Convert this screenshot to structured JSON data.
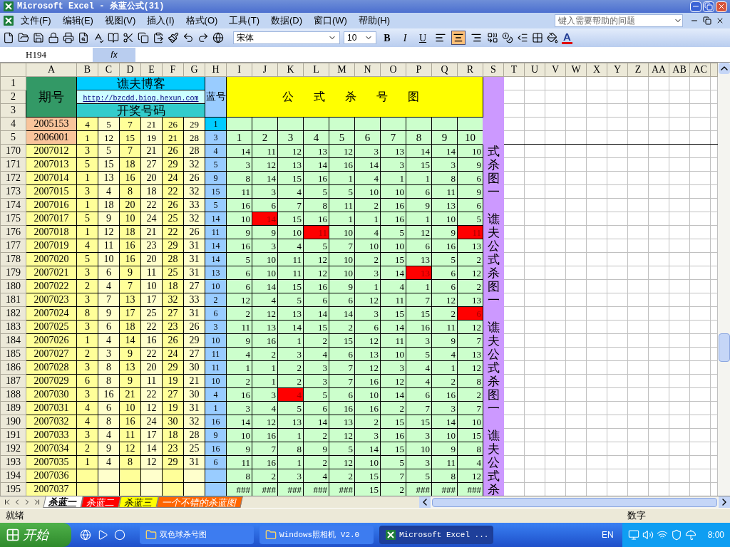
{
  "window": {
    "title": "Microsoft Excel - 杀蓝公式(31)"
  },
  "menu": [
    "文件(F)",
    "编辑(E)",
    "视图(V)",
    "插入(I)",
    "格式(O)",
    "工具(T)",
    "数据(D)",
    "窗口(W)",
    "帮助(H)"
  ],
  "help_box": {
    "placeholder": "键入需要帮助的问题"
  },
  "toolbar": {
    "font": "宋体",
    "size": "10",
    "styles": [
      "B",
      "I",
      "U"
    ],
    "align": [
      {
        "kind": "left",
        "selected": false
      },
      {
        "kind": "center",
        "selected": true
      },
      {
        "kind": "right",
        "selected": false
      }
    ],
    "font_color_label": "A"
  },
  "formula_bar": {
    "name_box": "H194",
    "fx": "fx"
  },
  "columns": [
    "A",
    "B",
    "C",
    "D",
    "E",
    "F",
    "G",
    "H",
    "I",
    "J",
    "K",
    "L",
    "M",
    "N",
    "O",
    "P",
    "Q",
    "R",
    "S",
    "T",
    "U",
    "V",
    "W",
    "X",
    "Y",
    "Z",
    "AA",
    "AB",
    "AC"
  ],
  "header": {
    "rows": [
      "1",
      "2",
      "3"
    ],
    "period_label": "期号",
    "blog": "谯夫博客",
    "link": "http://bzcdd.biog.hexun.com",
    "draw_label": "开奖号码",
    "blue_label": "蓝号",
    "chart_title": "公 式 杀 号 图"
  },
  "top_rows": [
    {
      "row": "4",
      "period": "2005153",
      "numbers": [
        "4",
        "5",
        "7",
        "21",
        "26",
        "29"
      ],
      "blue": "1"
    },
    {
      "row": "5",
      "period": "2006001",
      "numbers": [
        "1",
        "12",
        "15",
        "19",
        "21",
        "28"
      ],
      "blue": "3",
      "formula": [
        "1",
        "2",
        "3",
        "4",
        "5",
        "6",
        "7",
        "8",
        "9",
        "10"
      ]
    }
  ],
  "rows": [
    {
      "row": "170",
      "period": "2007012",
      "numbers": [
        "3",
        "5",
        "7",
        "21",
        "26",
        "28"
      ],
      "blue": "4",
      "side": "式",
      "formula": [
        {
          "v": "14",
          "hit": false
        },
        {
          "v": "11",
          "hit": false
        },
        {
          "v": "12",
          "hit": false
        },
        {
          "v": "13",
          "hit": false
        },
        {
          "v": "12",
          "hit": false
        },
        {
          "v": "3",
          "hit": false
        },
        {
          "v": "13",
          "hit": false
        },
        {
          "v": "14",
          "hit": false
        },
        {
          "v": "14",
          "hit": false
        },
        {
          "v": "10",
          "hit": false
        }
      ]
    },
    {
      "row": "171",
      "period": "2007013",
      "numbers": [
        "5",
        "15",
        "18",
        "27",
        "29",
        "32"
      ],
      "blue": "5",
      "side": "杀",
      "formula": [
        {
          "v": "3",
          "hit": false
        },
        {
          "v": "12",
          "hit": false
        },
        {
          "v": "13",
          "hit": false
        },
        {
          "v": "14",
          "hit": false
        },
        {
          "v": "16",
          "hit": false
        },
        {
          "v": "14",
          "hit": false
        },
        {
          "v": "3",
          "hit": false
        },
        {
          "v": "15",
          "hit": false
        },
        {
          "v": "3",
          "hit": false
        },
        {
          "v": "9",
          "hit": false
        }
      ]
    },
    {
      "row": "172",
      "period": "2007014",
      "numbers": [
        "1",
        "13",
        "16",
        "20",
        "24",
        "26"
      ],
      "blue": "9",
      "side": "图",
      "formula": [
        {
          "v": "8",
          "hit": false
        },
        {
          "v": "14",
          "hit": false
        },
        {
          "v": "15",
          "hit": false
        },
        {
          "v": "16",
          "hit": false
        },
        {
          "v": "1",
          "hit": false
        },
        {
          "v": "4",
          "hit": false
        },
        {
          "v": "1",
          "hit": false
        },
        {
          "v": "1",
          "hit": false
        },
        {
          "v": "8",
          "hit": false
        },
        {
          "v": "6",
          "hit": false
        }
      ]
    },
    {
      "row": "173",
      "period": "2007015",
      "numbers": [
        "3",
        "4",
        "8",
        "18",
        "22",
        "32"
      ],
      "blue": "15",
      "side": "一",
      "formula": [
        {
          "v": "11",
          "hit": false
        },
        {
          "v": "3",
          "hit": false
        },
        {
          "v": "4",
          "hit": false
        },
        {
          "v": "5",
          "hit": false
        },
        {
          "v": "5",
          "hit": false
        },
        {
          "v": "10",
          "hit": false
        },
        {
          "v": "10",
          "hit": false
        },
        {
          "v": "6",
          "hit": false
        },
        {
          "v": "11",
          "hit": false
        },
        {
          "v": "9",
          "hit": false
        }
      ]
    },
    {
      "row": "174",
      "period": "2007016",
      "numbers": [
        "1",
        "18",
        "20",
        "22",
        "26",
        "33"
      ],
      "blue": "5",
      "formula": [
        {
          "v": "16",
          "hit": false
        },
        {
          "v": "6",
          "hit": false
        },
        {
          "v": "7",
          "hit": false
        },
        {
          "v": "8",
          "hit": false
        },
        {
          "v": "11",
          "hit": false
        },
        {
          "v": "2",
          "hit": false
        },
        {
          "v": "16",
          "hit": false
        },
        {
          "v": "9",
          "hit": false
        },
        {
          "v": "13",
          "hit": false
        },
        {
          "v": "6",
          "hit": false
        }
      ]
    },
    {
      "row": "175",
      "period": "2007017",
      "numbers": [
        "5",
        "9",
        "10",
        "24",
        "25",
        "32"
      ],
      "blue": "14",
      "side": "谯",
      "formula": [
        {
          "v": "10",
          "hit": false
        },
        {
          "v": "14",
          "hit": true
        },
        {
          "v": "15",
          "hit": false
        },
        {
          "v": "16",
          "hit": false
        },
        {
          "v": "1",
          "hit": false
        },
        {
          "v": "1",
          "hit": false
        },
        {
          "v": "16",
          "hit": false
        },
        {
          "v": "1",
          "hit": false
        },
        {
          "v": "10",
          "hit": false
        },
        {
          "v": "5",
          "hit": false
        }
      ]
    },
    {
      "row": "176",
      "period": "2007018",
      "numbers": [
        "1",
        "12",
        "18",
        "21",
        "22",
        "26"
      ],
      "blue": "11",
      "side": "夫",
      "formula": [
        {
          "v": "9",
          "hit": false
        },
        {
          "v": "9",
          "hit": false
        },
        {
          "v": "10",
          "hit": false
        },
        {
          "v": "11",
          "hit": true
        },
        {
          "v": "10",
          "hit": false
        },
        {
          "v": "4",
          "hit": false
        },
        {
          "v": "5",
          "hit": false
        },
        {
          "v": "12",
          "hit": false
        },
        {
          "v": "9",
          "hit": false
        },
        {
          "v": "11",
          "hit": true
        }
      ]
    },
    {
      "row": "177",
      "period": "2007019",
      "numbers": [
        "4",
        "11",
        "16",
        "23",
        "29",
        "31"
      ],
      "blue": "14",
      "side": "公",
      "formula": [
        {
          "v": "16",
          "hit": false
        },
        {
          "v": "3",
          "hit": false
        },
        {
          "v": "4",
          "hit": false
        },
        {
          "v": "5",
          "hit": false
        },
        {
          "v": "7",
          "hit": false
        },
        {
          "v": "10",
          "hit": false
        },
        {
          "v": "10",
          "hit": false
        },
        {
          "v": "6",
          "hit": false
        },
        {
          "v": "16",
          "hit": false
        },
        {
          "v": "13",
          "hit": false
        }
      ]
    },
    {
      "row": "178",
      "period": "2007020",
      "numbers": [
        "5",
        "10",
        "16",
        "20",
        "28",
        "31"
      ],
      "blue": "14",
      "side": "式",
      "formula": [
        {
          "v": "5",
          "hit": false
        },
        {
          "v": "10",
          "hit": false
        },
        {
          "v": "11",
          "hit": false
        },
        {
          "v": "12",
          "hit": false
        },
        {
          "v": "10",
          "hit": false
        },
        {
          "v": "2",
          "hit": false
        },
        {
          "v": "15",
          "hit": false
        },
        {
          "v": "13",
          "hit": false
        },
        {
          "v": "5",
          "hit": false
        },
        {
          "v": "2",
          "hit": false
        }
      ]
    },
    {
      "row": "179",
      "period": "2007021",
      "numbers": [
        "3",
        "6",
        "9",
        "11",
        "25",
        "31"
      ],
      "blue": "13",
      "side": "杀",
      "formula": [
        {
          "v": "6",
          "hit": false
        },
        {
          "v": "10",
          "hit": false
        },
        {
          "v": "11",
          "hit": false
        },
        {
          "v": "12",
          "hit": false
        },
        {
          "v": "10",
          "hit": false
        },
        {
          "v": "3",
          "hit": false
        },
        {
          "v": "14",
          "hit": false
        },
        {
          "v": "13",
          "hit": true
        },
        {
          "v": "6",
          "hit": false
        },
        {
          "v": "12",
          "hit": false
        }
      ]
    },
    {
      "row": "180",
      "period": "2007022",
      "numbers": [
        "2",
        "4",
        "7",
        "10",
        "18",
        "27"
      ],
      "blue": "10",
      "side": "图",
      "formula": [
        {
          "v": "6",
          "hit": false
        },
        {
          "v": "14",
          "hit": false
        },
        {
          "v": "15",
          "hit": false
        },
        {
          "v": "16",
          "hit": false
        },
        {
          "v": "9",
          "hit": false
        },
        {
          "v": "1",
          "hit": false
        },
        {
          "v": "4",
          "hit": false
        },
        {
          "v": "1",
          "hit": false
        },
        {
          "v": "6",
          "hit": false
        },
        {
          "v": "2",
          "hit": false
        }
      ]
    },
    {
      "row": "181",
      "period": "2007023",
      "numbers": [
        "3",
        "7",
        "13",
        "17",
        "32",
        "33"
      ],
      "blue": "2",
      "side": "一",
      "formula": [
        {
          "v": "12",
          "hit": false
        },
        {
          "v": "4",
          "hit": false
        },
        {
          "v": "5",
          "hit": false
        },
        {
          "v": "6",
          "hit": false
        },
        {
          "v": "6",
          "hit": false
        },
        {
          "v": "12",
          "hit": false
        },
        {
          "v": "11",
          "hit": false
        },
        {
          "v": "7",
          "hit": false
        },
        {
          "v": "12",
          "hit": false
        },
        {
          "v": "13",
          "hit": false
        }
      ]
    },
    {
      "row": "182",
      "period": "2007024",
      "numbers": [
        "8",
        "9",
        "17",
        "25",
        "27",
        "31"
      ],
      "blue": "6",
      "formula": [
        {
          "v": "2",
          "hit": false
        },
        {
          "v": "12",
          "hit": false
        },
        {
          "v": "13",
          "hit": false
        },
        {
          "v": "14",
          "hit": false
        },
        {
          "v": "14",
          "hit": false
        },
        {
          "v": "3",
          "hit": false
        },
        {
          "v": "15",
          "hit": false
        },
        {
          "v": "15",
          "hit": false
        },
        {
          "v": "2",
          "hit": false
        },
        {
          "v": "6",
          "hit": true
        }
      ]
    },
    {
      "row": "183",
      "period": "2007025",
      "numbers": [
        "3",
        "6",
        "18",
        "22",
        "23",
        "26"
      ],
      "blue": "3",
      "side": "谯",
      "formula": [
        {
          "v": "11",
          "hit": false
        },
        {
          "v": "13",
          "hit": false
        },
        {
          "v": "14",
          "hit": false
        },
        {
          "v": "15",
          "hit": false
        },
        {
          "v": "2",
          "hit": false
        },
        {
          "v": "6",
          "hit": false
        },
        {
          "v": "14",
          "hit": false
        },
        {
          "v": "16",
          "hit": false
        },
        {
          "v": "11",
          "hit": false
        },
        {
          "v": "12",
          "hit": false
        }
      ]
    },
    {
      "row": "184",
      "period": "2007026",
      "numbers": [
        "1",
        "4",
        "14",
        "16",
        "26",
        "29"
      ],
      "blue": "10",
      "side": "夫",
      "formula": [
        {
          "v": "9",
          "hit": false
        },
        {
          "v": "16",
          "hit": false
        },
        {
          "v": "1",
          "hit": false
        },
        {
          "v": "2",
          "hit": false
        },
        {
          "v": "15",
          "hit": false
        },
        {
          "v": "12",
          "hit": false
        },
        {
          "v": "11",
          "hit": false
        },
        {
          "v": "3",
          "hit": false
        },
        {
          "v": "9",
          "hit": false
        },
        {
          "v": "7",
          "hit": false
        }
      ]
    },
    {
      "row": "185",
      "period": "2007027",
      "numbers": [
        "2",
        "3",
        "9",
        "22",
        "24",
        "27"
      ],
      "blue": "11",
      "side": "公",
      "formula": [
        {
          "v": "4",
          "hit": false
        },
        {
          "v": "2",
          "hit": false
        },
        {
          "v": "3",
          "hit": false
        },
        {
          "v": "4",
          "hit": false
        },
        {
          "v": "6",
          "hit": false
        },
        {
          "v": "13",
          "hit": false
        },
        {
          "v": "10",
          "hit": false
        },
        {
          "v": "5",
          "hit": false
        },
        {
          "v": "4",
          "hit": false
        },
        {
          "v": "13",
          "hit": false
        }
      ]
    },
    {
      "row": "186",
      "period": "2007028",
      "numbers": [
        "3",
        "8",
        "13",
        "20",
        "29",
        "30"
      ],
      "blue": "11",
      "side": "式",
      "formula": [
        {
          "v": "1",
          "hit": false
        },
        {
          "v": "1",
          "hit": false
        },
        {
          "v": "2",
          "hit": false
        },
        {
          "v": "3",
          "hit": false
        },
        {
          "v": "7",
          "hit": false
        },
        {
          "v": "12",
          "hit": false
        },
        {
          "v": "3",
          "hit": false
        },
        {
          "v": "4",
          "hit": false
        },
        {
          "v": "1",
          "hit": false
        },
        {
          "v": "12",
          "hit": false
        }
      ]
    },
    {
      "row": "187",
      "period": "2007029",
      "numbers": [
        "6",
        "8",
        "9",
        "11",
        "19",
        "21"
      ],
      "blue": "10",
      "side": "杀",
      "formula": [
        {
          "v": "2",
          "hit": false
        },
        {
          "v": "1",
          "hit": false
        },
        {
          "v": "2",
          "hit": false
        },
        {
          "v": "3",
          "hit": false
        },
        {
          "v": "7",
          "hit": false
        },
        {
          "v": "16",
          "hit": false
        },
        {
          "v": "12",
          "hit": false
        },
        {
          "v": "4",
          "hit": false
        },
        {
          "v": "2",
          "hit": false
        },
        {
          "v": "8",
          "hit": false
        }
      ]
    },
    {
      "row": "188",
      "period": "2007030",
      "numbers": [
        "3",
        "16",
        "21",
        "22",
        "27",
        "30"
      ],
      "blue": "4",
      "side": "图",
      "formula": [
        {
          "v": "16",
          "hit": false
        },
        {
          "v": "3",
          "hit": false
        },
        {
          "v": "4",
          "hit": true
        },
        {
          "v": "5",
          "hit": false
        },
        {
          "v": "6",
          "hit": false
        },
        {
          "v": "10",
          "hit": false
        },
        {
          "v": "14",
          "hit": false
        },
        {
          "v": "6",
          "hit": false
        },
        {
          "v": "16",
          "hit": false
        },
        {
          "v": "2",
          "hit": false
        }
      ]
    },
    {
      "row": "189",
      "period": "2007031",
      "numbers": [
        "4",
        "6",
        "10",
        "12",
        "19",
        "31"
      ],
      "blue": "1",
      "side": "一",
      "formula": [
        {
          "v": "3",
          "hit": false
        },
        {
          "v": "4",
          "hit": false
        },
        {
          "v": "5",
          "hit": false
        },
        {
          "v": "6",
          "hit": false
        },
        {
          "v": "16",
          "hit": false
        },
        {
          "v": "16",
          "hit": false
        },
        {
          "v": "2",
          "hit": false
        },
        {
          "v": "7",
          "hit": false
        },
        {
          "v": "3",
          "hit": false
        },
        {
          "v": "7",
          "hit": false
        }
      ]
    },
    {
      "row": "190",
      "period": "2007032",
      "numbers": [
        "4",
        "8",
        "16",
        "24",
        "30",
        "32"
      ],
      "blue": "16",
      "formula": [
        {
          "v": "14",
          "hit": false
        },
        {
          "v": "12",
          "hit": false
        },
        {
          "v": "13",
          "hit": false
        },
        {
          "v": "14",
          "hit": false
        },
        {
          "v": "13",
          "hit": false
        },
        {
          "v": "2",
          "hit": false
        },
        {
          "v": "15",
          "hit": false
        },
        {
          "v": "15",
          "hit": false
        },
        {
          "v": "14",
          "hit": false
        },
        {
          "v": "10",
          "hit": false
        }
      ]
    },
    {
      "row": "191",
      "period": "2007033",
      "numbers": [
        "3",
        "4",
        "11",
        "17",
        "18",
        "28"
      ],
      "blue": "9",
      "side": "谯",
      "formula": [
        {
          "v": "10",
          "hit": false
        },
        {
          "v": "16",
          "hit": false
        },
        {
          "v": "1",
          "hit": false
        },
        {
          "v": "2",
          "hit": false
        },
        {
          "v": "12",
          "hit": false
        },
        {
          "v": "3",
          "hit": false
        },
        {
          "v": "16",
          "hit": false
        },
        {
          "v": "3",
          "hit": false
        },
        {
          "v": "10",
          "hit": false
        },
        {
          "v": "15",
          "hit": false
        }
      ]
    },
    {
      "row": "192",
      "period": "2007034",
      "numbers": [
        "2",
        "9",
        "12",
        "14",
        "23",
        "25"
      ],
      "blue": "16",
      "side": "夫",
      "formula": [
        {
          "v": "9",
          "hit": false
        },
        {
          "v": "7",
          "hit": false
        },
        {
          "v": "8",
          "hit": false
        },
        {
          "v": "9",
          "hit": false
        },
        {
          "v": "5",
          "hit": false
        },
        {
          "v": "14",
          "hit": false
        },
        {
          "v": "15",
          "hit": false
        },
        {
          "v": "10",
          "hit": false
        },
        {
          "v": "9",
          "hit": false
        },
        {
          "v": "8",
          "hit": false
        }
      ]
    },
    {
      "row": "193",
      "period": "2007035",
      "numbers": [
        "1",
        "4",
        "8",
        "12",
        "29",
        "31"
      ],
      "blue": "6",
      "side": "公",
      "formula": [
        {
          "v": "11",
          "hit": false
        },
        {
          "v": "16",
          "hit": false
        },
        {
          "v": "1",
          "hit": false
        },
        {
          "v": "2",
          "hit": false
        },
        {
          "v": "12",
          "hit": false
        },
        {
          "v": "10",
          "hit": false
        },
        {
          "v": "5",
          "hit": false
        },
        {
          "v": "3",
          "hit": false
        },
        {
          "v": "11",
          "hit": false
        },
        {
          "v": "4",
          "hit": false
        }
      ]
    },
    {
      "row": "194",
      "period": "2007036",
      "side": "式",
      "formula": [
        {
          "v": "8",
          "hit": false
        },
        {
          "v": "2",
          "hit": false
        },
        {
          "v": "3",
          "hit": false
        },
        {
          "v": "4",
          "hit": false
        },
        {
          "v": "2",
          "hit": false
        },
        {
          "v": "15",
          "hit": false
        },
        {
          "v": "7",
          "hit": false
        },
        {
          "v": "5",
          "hit": false
        },
        {
          "v": "8",
          "hit": false
        },
        {
          "v": "12",
          "hit": false
        }
      ]
    },
    {
      "row": "195",
      "period": "2007037",
      "side": "杀",
      "formula": [
        {
          "v": "###",
          "hit": false
        },
        {
          "v": "###",
          "hit": false
        },
        {
          "v": "###",
          "hit": false
        },
        {
          "v": "###",
          "hit": false
        },
        {
          "v": "###",
          "hit": false
        },
        {
          "v": "15",
          "hit": false
        },
        {
          "v": "2",
          "hit": false
        },
        {
          "v": "###",
          "hit": false
        },
        {
          "v": "###",
          "hit": false
        },
        {
          "v": "###",
          "hit": false
        }
      ]
    }
  ],
  "sheets": [
    {
      "label": "杀蓝一",
      "selected": true,
      "color": "#ffffff"
    },
    {
      "label": "杀蓝二",
      "selected": false,
      "color": "#ff0000"
    },
    {
      "label": "杀蓝三",
      "selected": false,
      "color": "#ffff00"
    },
    {
      "label": "一个不错的杀蓝图",
      "selected": false,
      "color": "#ff6600"
    }
  ],
  "status_bar": {
    "left": "就绪",
    "mode": "数字"
  },
  "taskbar": {
    "start": "开始",
    "tasks": [
      {
        "label": "双色球杀号图",
        "kind": "folder",
        "selected": false
      },
      {
        "label": "Windows照相机 V2.0",
        "kind": "folder",
        "selected": false
      },
      {
        "label": "Microsoft Excel ...",
        "kind": "excel",
        "selected": true
      }
    ],
    "language": "EN",
    "clock": "8:00"
  }
}
